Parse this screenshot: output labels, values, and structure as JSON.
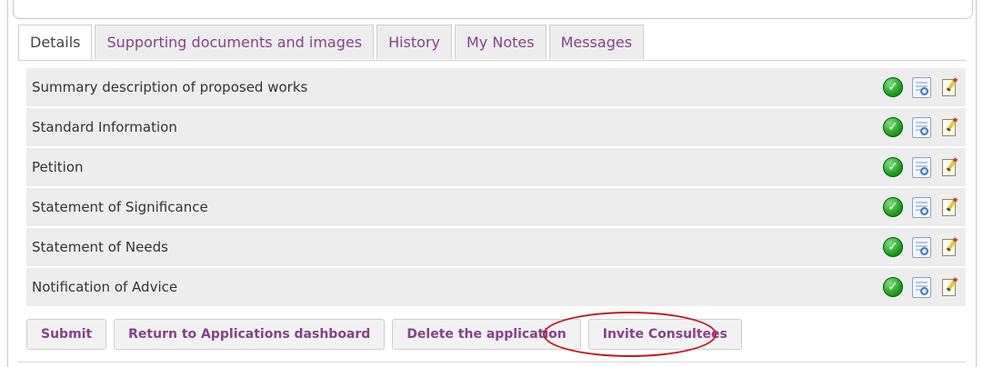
{
  "tabs": [
    {
      "label": "Details",
      "active": true
    },
    {
      "label": "Supporting documents and images",
      "active": false
    },
    {
      "label": "History",
      "active": false
    },
    {
      "label": "My Notes",
      "active": false
    },
    {
      "label": "Messages",
      "active": false
    }
  ],
  "sections": [
    {
      "label": "Summary description of proposed works",
      "status": "complete"
    },
    {
      "label": "Standard Information",
      "status": "complete"
    },
    {
      "label": "Petition",
      "status": "complete"
    },
    {
      "label": "Statement of Significance",
      "status": "complete"
    },
    {
      "label": "Statement of Needs",
      "status": "complete"
    },
    {
      "label": "Notification of Advice",
      "status": "complete"
    }
  ],
  "row_icons": {
    "status": "check-circle-icon",
    "view": "view-document-icon",
    "edit": "edit-icon"
  },
  "actions": {
    "submit": "Submit",
    "return": "Return to Applications dashboard",
    "delete": "Delete the application",
    "invite": "Invite Consultees"
  },
  "colors": {
    "accent": "#8a3f8f",
    "row_background": "#ededed",
    "highlight": "#c21a1a",
    "check": "#1e9a1e"
  }
}
